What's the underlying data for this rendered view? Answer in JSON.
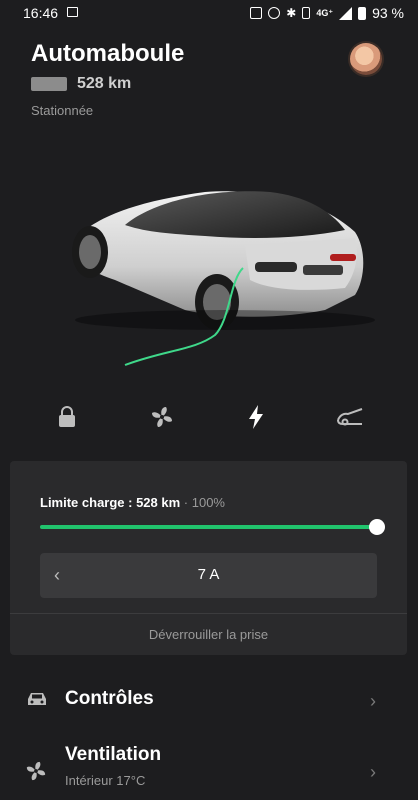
{
  "status_bar": {
    "time": "16:46",
    "network": "4G⁺",
    "battery": "93 %"
  },
  "vehicle": {
    "name": "Automaboule",
    "range": "528 km",
    "state": "Stationnée"
  },
  "actions": [
    {
      "name": "lock",
      "icon": "lock-icon"
    },
    {
      "name": "climate",
      "icon": "fan-icon"
    },
    {
      "name": "charge",
      "icon": "bolt-icon"
    },
    {
      "name": "trunk",
      "icon": "trunk-icon"
    }
  ],
  "charge": {
    "limit_label": "Limite charge : 528 km",
    "limit_pct": "100%",
    "limit_fraction": 1.0,
    "amp_value": "7 A",
    "amp_prev": "‹",
    "unlock_label": "Déverrouiller la prise",
    "accent": "#21c46d"
  },
  "menu": [
    {
      "title": "Contrôles",
      "subtitle": "",
      "icon": "car-icon"
    },
    {
      "title": "Ventilation",
      "subtitle": "Intérieur 17°C",
      "icon": "fan-icon"
    }
  ]
}
